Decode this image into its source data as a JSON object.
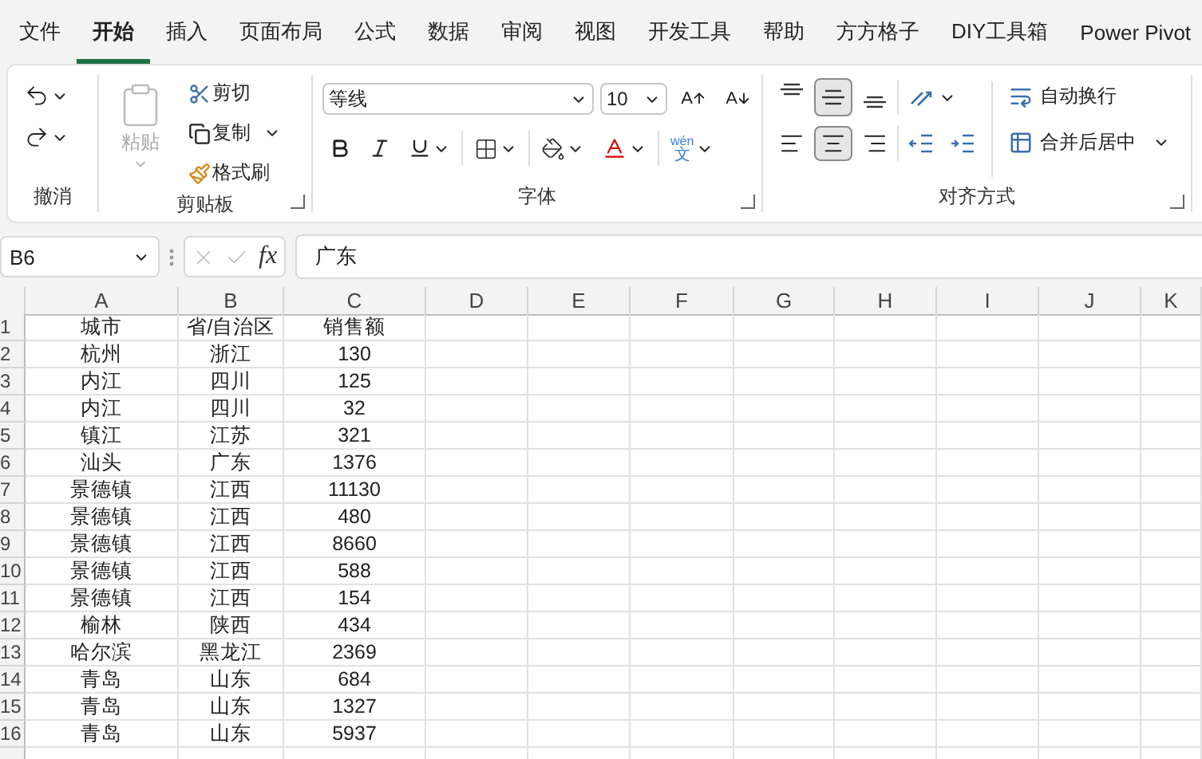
{
  "menu_tabs": [
    {
      "label": "文件",
      "selected": false
    },
    {
      "label": "开始",
      "selected": true
    },
    {
      "label": "插入",
      "selected": false
    },
    {
      "label": "页面布局",
      "selected": false
    },
    {
      "label": "公式",
      "selected": false
    },
    {
      "label": "数据",
      "selected": false
    },
    {
      "label": "审阅",
      "selected": false
    },
    {
      "label": "视图",
      "selected": false
    },
    {
      "label": "开发工具",
      "selected": false
    },
    {
      "label": "帮助",
      "selected": false
    },
    {
      "label": "方方格子",
      "selected": false
    },
    {
      "label": "DIY工具箱",
      "selected": false
    },
    {
      "label": "Power Pivot",
      "selected": false
    }
  ],
  "undo": {
    "label": "撤消"
  },
  "clipboard": {
    "label": "剪贴板",
    "paste": "粘贴",
    "cut": "剪切",
    "copy": "复制",
    "format_painter": "格式刷"
  },
  "font": {
    "label": "字体",
    "font_name": "等线",
    "font_size": "10",
    "phonetic_top": "wén",
    "phonetic_bottom": "文"
  },
  "alignment": {
    "label": "对齐方式",
    "vertical": [
      {
        "kind": "top",
        "selected": false
      },
      {
        "kind": "middle",
        "selected": true
      },
      {
        "kind": "bottom",
        "selected": false
      }
    ],
    "horizontal": [
      {
        "kind": "left",
        "selected": false
      },
      {
        "kind": "center",
        "selected": true
      },
      {
        "kind": "right",
        "selected": false
      }
    ],
    "wrap_text": "自动换行",
    "merge_center": "合并后居中"
  },
  "formula_bar": {
    "name_box": "B6",
    "function_label": "fx",
    "formula": "广东"
  },
  "sheet": {
    "columns": [
      "A",
      "B",
      "C",
      "D",
      "E",
      "F",
      "G",
      "H",
      "I",
      "J",
      "K"
    ],
    "rows": [
      {
        "number": "1",
        "cells": [
          "城市",
          "省/自治区",
          "销售额"
        ]
      },
      {
        "number": "2",
        "cells": [
          "杭州",
          "浙江",
          "130"
        ]
      },
      {
        "number": "3",
        "cells": [
          "内江",
          "四川",
          "125"
        ]
      },
      {
        "number": "4",
        "cells": [
          "内江",
          "四川",
          "32"
        ]
      },
      {
        "number": "5",
        "cells": [
          "镇江",
          "江苏",
          "321"
        ]
      },
      {
        "number": "6",
        "cells": [
          "汕头",
          "广东",
          "1376"
        ]
      },
      {
        "number": "7",
        "cells": [
          "景德镇",
          "江西",
          "11130"
        ]
      },
      {
        "number": "8",
        "cells": [
          "景德镇",
          "江西",
          "480"
        ]
      },
      {
        "number": "9",
        "cells": [
          "景德镇",
          "江西",
          "8660"
        ]
      },
      {
        "number": "10",
        "cells": [
          "景德镇",
          "江西",
          "588"
        ]
      },
      {
        "number": "11",
        "cells": [
          "景德镇",
          "江西",
          "154"
        ]
      },
      {
        "number": "12",
        "cells": [
          "榆林",
          "陕西",
          "434"
        ]
      },
      {
        "number": "13",
        "cells": [
          "哈尔滨",
          "黑龙江",
          "2369"
        ]
      },
      {
        "number": "14",
        "cells": [
          "青岛",
          "山东",
          "684"
        ]
      },
      {
        "number": "15",
        "cells": [
          "青岛",
          "山东",
          "1327"
        ]
      },
      {
        "number": "16",
        "cells": [
          "青岛",
          "山东",
          "5937"
        ]
      }
    ]
  }
}
